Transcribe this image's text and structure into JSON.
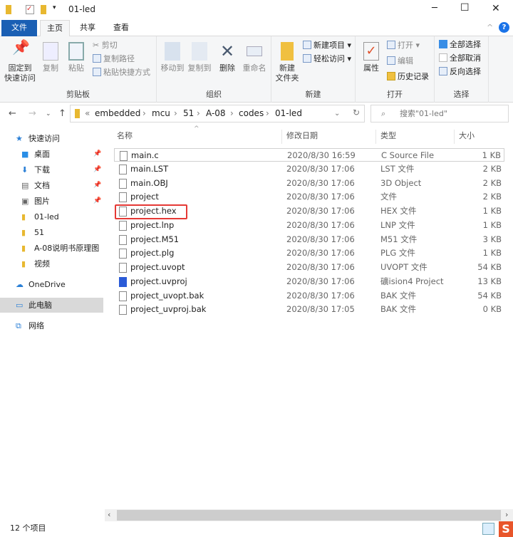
{
  "window": {
    "title": "01-led",
    "min": "─",
    "max": "☐",
    "close": "✕"
  },
  "tabs": [
    "文件",
    "主页",
    "共享",
    "查看"
  ],
  "ribbon": {
    "clipboard": {
      "label": "剪贴板",
      "pin": "固定到\n快速访问",
      "copy": "复制",
      "paste": "粘贴",
      "cut": "剪切",
      "copy_path": "复制路径",
      "paste_shortcut": "粘贴快捷方式"
    },
    "organize": {
      "label": "组织",
      "move_to": "移动到",
      "copy_to": "复制到",
      "delete": "删除",
      "rename": "重命名"
    },
    "new": {
      "label": "新建",
      "new_folder": "新建\n文件夹",
      "new_item": "新建项目 ▾",
      "easy_access": "轻松访问 ▾"
    },
    "open": {
      "label": "打开",
      "properties": "属性",
      "open": "打开 ▾",
      "edit": "编辑",
      "history": "历史记录"
    },
    "select": {
      "label": "选择",
      "select_all": "全部选择",
      "select_none": "全部取消",
      "invert": "反向选择"
    }
  },
  "address": {
    "crumbs": [
      "«",
      "embedded",
      "›",
      "mcu",
      "›",
      "51",
      "›",
      "A-08",
      "›",
      "codes",
      "›",
      "01-led"
    ],
    "search_placeholder": "搜索\"01-led\""
  },
  "sidebar": [
    {
      "label": "快速访问",
      "icon": "star-icon"
    },
    {
      "label": "桌面",
      "icon": "desktop-icon",
      "pinned": true
    },
    {
      "label": "下载",
      "icon": "download-icon",
      "pinned": true
    },
    {
      "label": "文档",
      "icon": "document-icon",
      "pinned": true
    },
    {
      "label": "图片",
      "icon": "picture-icon",
      "pinned": true
    },
    {
      "label": "01-led",
      "icon": "folder-icon"
    },
    {
      "label": "51",
      "icon": "folder-icon"
    },
    {
      "label": "A-08说明书原理图",
      "icon": "folder-icon"
    },
    {
      "label": "视频",
      "icon": "video-icon"
    },
    {
      "label": "OneDrive",
      "icon": "cloud-icon"
    },
    {
      "label": "此电脑",
      "icon": "computer-icon",
      "selected": true
    },
    {
      "label": "网络",
      "icon": "network-icon"
    }
  ],
  "columns": [
    "名称",
    "修改日期",
    "类型",
    "大小"
  ],
  "files": [
    {
      "name": "main.c",
      "date": "2020/8/30 16:59",
      "type": "C Source File",
      "size": "1 KB"
    },
    {
      "name": "main.LST",
      "date": "2020/8/30 17:06",
      "type": "LST 文件",
      "size": "2 KB"
    },
    {
      "name": "main.OBJ",
      "date": "2020/8/30 17:06",
      "type": "3D Object",
      "size": "2 KB"
    },
    {
      "name": "project",
      "date": "2020/8/30 17:06",
      "type": "文件",
      "size": "2 KB"
    },
    {
      "name": "project.hex",
      "date": "2020/8/30 17:06",
      "type": "HEX 文件",
      "size": "1 KB"
    },
    {
      "name": "project.lnp",
      "date": "2020/8/30 17:06",
      "type": "LNP 文件",
      "size": "1 KB"
    },
    {
      "name": "project.M51",
      "date": "2020/8/30 17:06",
      "type": "M51 文件",
      "size": "3 KB"
    },
    {
      "name": "project.plg",
      "date": "2020/8/30 17:06",
      "type": "PLG 文件",
      "size": "1 KB"
    },
    {
      "name": "project.uvopt",
      "date": "2020/8/30 17:06",
      "type": "UVOPT 文件",
      "size": "54 KB"
    },
    {
      "name": "project.uvproj",
      "date": "2020/8/30 17:06",
      "type": "礦ision4 Project",
      "size": "13 KB"
    },
    {
      "name": "project_uvopt.bak",
      "date": "2020/8/30 17:06",
      "type": "BAK 文件",
      "size": "54 KB"
    },
    {
      "name": "project_uvproj.bak",
      "date": "2020/8/30 17:05",
      "type": "BAK 文件",
      "size": "0 KB"
    }
  ],
  "status": {
    "count": "12 个项目"
  }
}
